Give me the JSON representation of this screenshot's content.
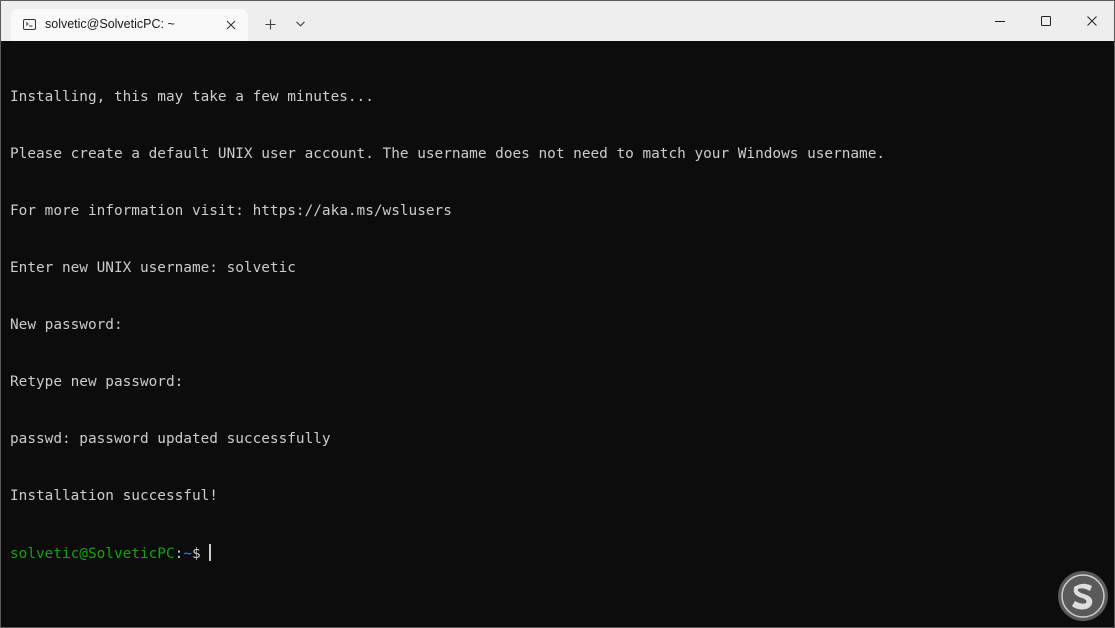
{
  "window": {
    "tab_title": "solvetic@SolveticPC: ~",
    "tab_icon": "terminal-icon",
    "new_tab_icon": "plus-icon",
    "dropdown_icon": "chevron-down-icon",
    "controls": [
      "minimize-icon",
      "maximize-icon",
      "close-icon"
    ]
  },
  "terminal": {
    "lines": [
      "Installing, this may take a few minutes...",
      "Please create a default UNIX user account. The username does not need to match your Windows username.",
      "For more information visit: https://aka.ms/wslusers",
      "Enter new UNIX username: solvetic",
      "New password:",
      "Retype new password:",
      "passwd: password updated successfully",
      "Installation successful!"
    ],
    "prompt": {
      "user_host": "solvetic@SolveticPC",
      "separator": ":",
      "path": "~",
      "symbol": "$"
    }
  },
  "colors": {
    "background": "#0c0c0c",
    "text": "#cccccc",
    "prompt_user": "#13a10e",
    "prompt_path": "#3b78ff"
  },
  "watermark": "solvetic-logo"
}
